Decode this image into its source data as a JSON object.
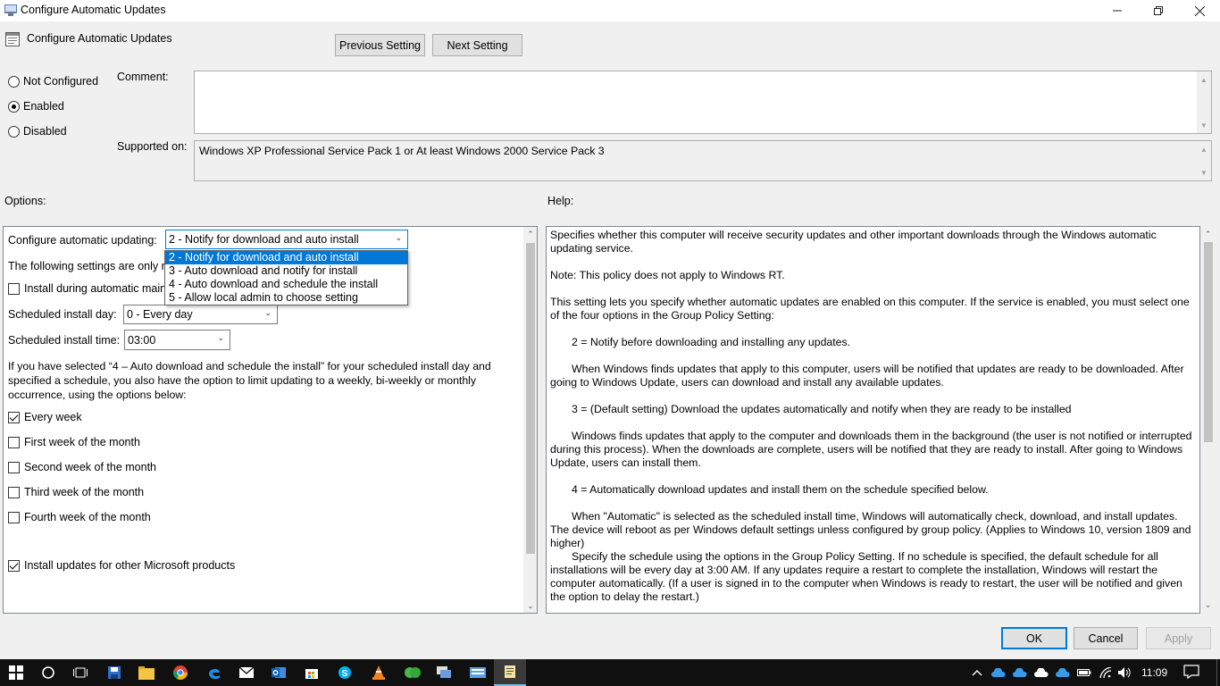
{
  "window": {
    "title": "Configure Automatic Updates",
    "icons": [
      "app-icon",
      "minimize-icon",
      "restore-icon",
      "close-icon"
    ]
  },
  "header": {
    "policy_title": "Configure Automatic Updates",
    "previous_label": "Previous Setting",
    "next_label": "Next Setting"
  },
  "state": {
    "not_configured": "Not Configured",
    "enabled": "Enabled",
    "disabled": "Disabled",
    "selected": "Enabled"
  },
  "comment": {
    "label": "Comment:",
    "value": ""
  },
  "supported": {
    "label": "Supported on:",
    "value": "Windows XP Professional Service Pack 1 or At least Windows 2000 Service Pack 3"
  },
  "options_label": "Options:",
  "help_label": "Help:",
  "options": {
    "configure_label": "Configure automatic updating:",
    "configure_value": "2 - Notify for download and auto install",
    "dropdown_items": [
      "2 - Notify for download and auto install",
      "3 - Auto download and notify for install",
      "4 - Auto download and schedule the install",
      "5 - Allow local admin to choose setting"
    ],
    "following_text": "The following settings are only re",
    "install_maint_label": "Install during automatic mainte",
    "install_maint_checked": false,
    "day_label": "Scheduled install day:",
    "day_value": "0 - Every day",
    "time_label": "Scheduled install time:",
    "time_value": "03:00",
    "schedule_note": "If you have selected “4 – Auto download and schedule the install” for your scheduled install day and specified a schedule, you also have the option to limit updating to a weekly, bi-weekly or monthly occurrence, using the options below:",
    "weeks": [
      {
        "label": "Every week",
        "checked": true
      },
      {
        "label": "First week of the month",
        "checked": false
      },
      {
        "label": "Second week of the month",
        "checked": false
      },
      {
        "label": "Third week of the month",
        "checked": false
      },
      {
        "label": "Fourth week of the month",
        "checked": false
      }
    ],
    "other_products_label": "Install updates for other Microsoft products",
    "other_products_checked": true
  },
  "help": {
    "p1": "Specifies whether this computer will receive security updates and other important downloads through the Windows automatic updating service.",
    "p2": "Note: This policy does not apply to Windows RT.",
    "p3": "This setting lets you specify whether automatic updates are enabled on this computer. If the service is enabled, you must select one of the four options in the Group Policy Setting:",
    "p4": "2 = Notify before downloading and installing any updates.",
    "p5": "When Windows finds updates that apply to this computer, users will be notified that updates are ready to be downloaded. After going to Windows Update, users can download and install any available updates.",
    "p6": "3 = (Default setting) Download the updates automatically and notify when they are ready to be installed",
    "p7": "Windows finds updates that apply to the computer and downloads them in the background (the user is not notified or interrupted during this process). When the downloads are complete, users will be notified that they are ready to install. After going to Windows Update, users can install them.",
    "p8": "4 = Automatically download updates and install them on the schedule specified below.",
    "p9": "When \"Automatic\" is selected as the scheduled install time, Windows will automatically check, download, and install updates. The device will reboot as per Windows default settings unless configured by group policy. (Applies to Windows 10, version 1809 and higher)",
    "p10": "Specify the schedule using the options in the Group Policy Setting. If no schedule is specified, the default schedule for all installations will be every day at 3:00 AM. If any updates require a restart to complete the installation, Windows will restart the computer automatically. (If a user is signed in to the computer when Windows is ready to restart, the user will be notified and given the option to delay the restart.)"
  },
  "footer": {
    "ok": "OK",
    "cancel": "Cancel",
    "apply": "Apply"
  },
  "taskbar": {
    "apps": [
      "start-icon",
      "search-icon",
      "task-view-icon",
      "save-disk-icon",
      "file-explorer-icon",
      "chrome-icon",
      "edge-icon",
      "mail-icon",
      "outlook-icon",
      "store-icon",
      "skype-icon",
      "vlc-icon",
      "green-app-icon",
      "remote-desktop-icon",
      "keyboard-app-icon",
      "policy-editor-icon"
    ],
    "tray_icons": [
      "chevron-up-icon",
      "onedrive-icon",
      "onedrive-icon",
      "cloud-icon",
      "onedrive-icon",
      "battery-icon",
      "wifi-icon",
      "volume-icon"
    ],
    "time": "11:09"
  },
  "colors": {
    "accent": "#0078d7",
    "taskbar": "#101010",
    "window_bg": "#f0f0f0"
  }
}
